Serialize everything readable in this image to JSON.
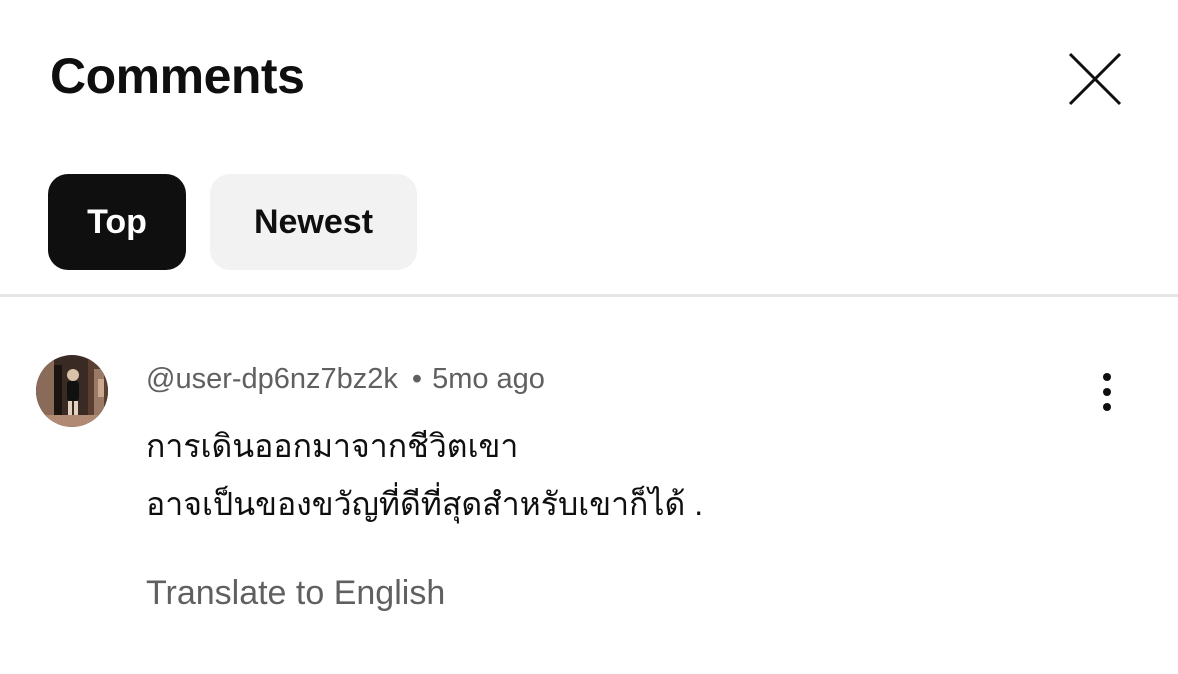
{
  "header": {
    "title": "Comments",
    "close_icon": "close-icon"
  },
  "filters": {
    "items": [
      {
        "label": "Top",
        "selected": true
      },
      {
        "label": "Newest",
        "selected": false
      }
    ]
  },
  "comments": [
    {
      "author": "@user-dp6nz7bz2k",
      "separator": "•",
      "time": "5mo ago",
      "text_lines": [
        "การเดินออกมาจากชีวิตเขา",
        "อาจเป็นของขวัญที่ดีที่สุดสำหรับเขาก็ได้ ."
      ],
      "translate_label": "Translate to English",
      "menu_icon": "more-vertical-icon",
      "avatar_icon": "avatar"
    }
  ],
  "colors": {
    "chip_active_bg": "#0f0f0f",
    "chip_inactive_bg": "#f2f2f2",
    "secondary_text": "#606060",
    "divider": "#e5e5e5"
  }
}
